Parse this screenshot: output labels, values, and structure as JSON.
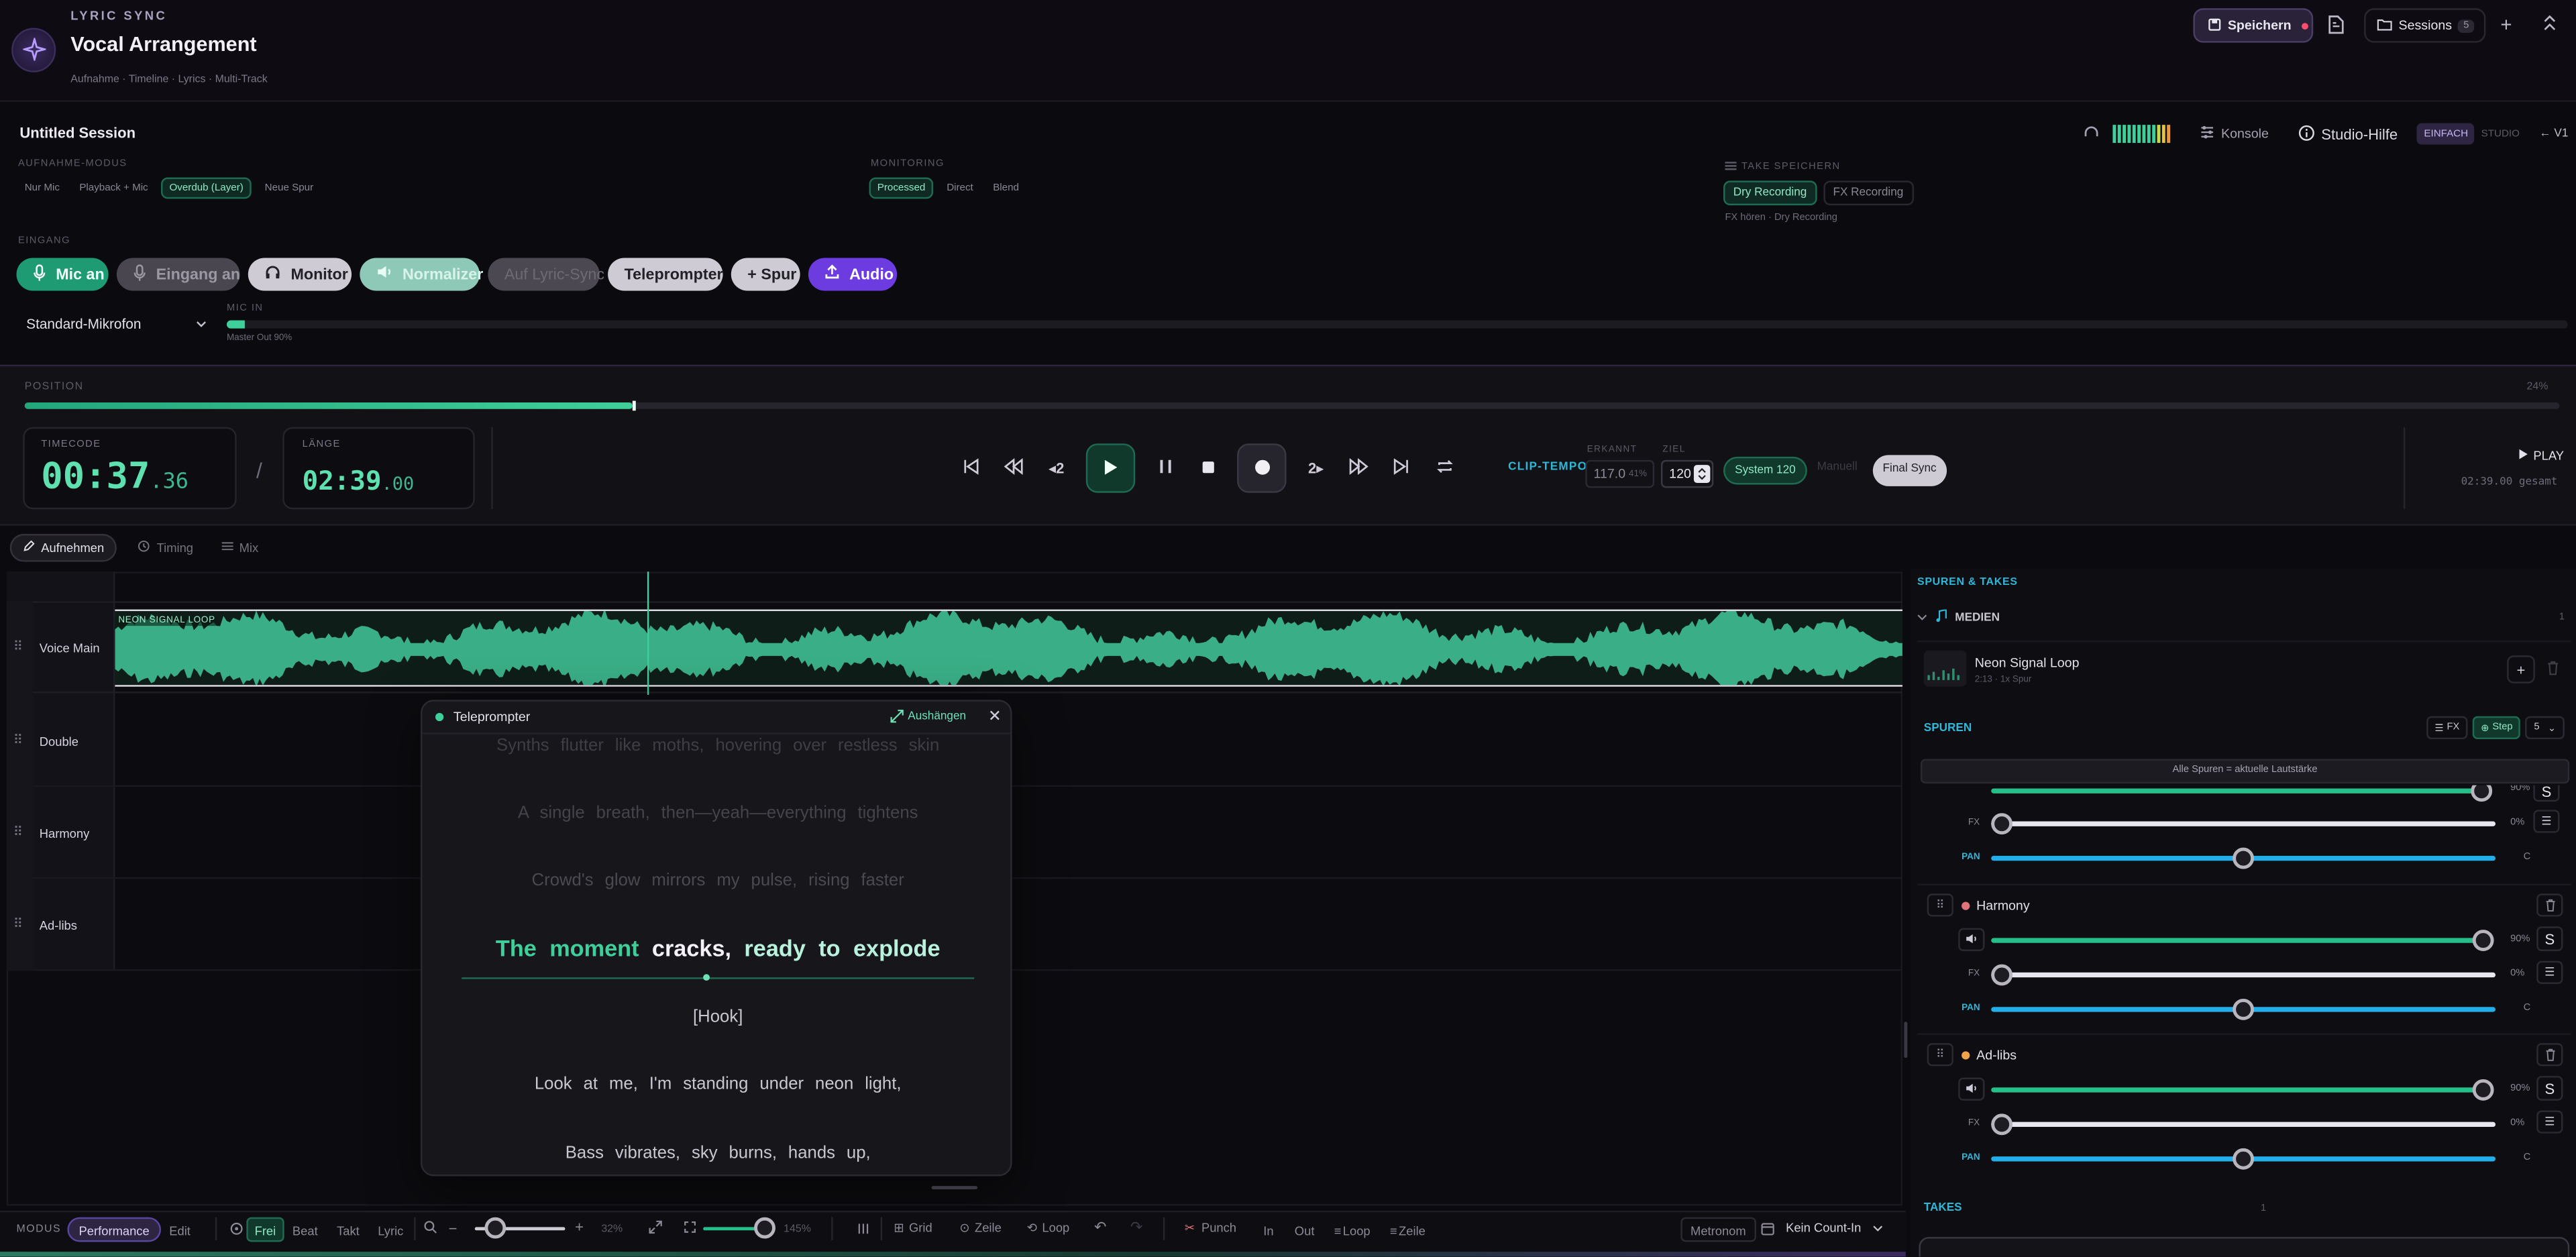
{
  "app": {
    "eyebrow": "LYRIC SYNC",
    "title": "Vocal Arrangement",
    "subtitle": "Aufnahme · Timeline · Lyrics · Multi-Track",
    "save": "Speichern",
    "sessions": "Sessions",
    "sessions_count": "5"
  },
  "session": {
    "name": "Untitled Session",
    "console": "Konsole",
    "help": "Studio-Hilfe",
    "mode_simple": "EINFACH",
    "mode_studio": "STUDIO",
    "version": "V1"
  },
  "record_mode": {
    "label": "AUFNAHME-MODUS",
    "options": [
      "Nur Mic",
      "Playback + Mic",
      "Overdub (Layer)",
      "Neue Spur"
    ]
  },
  "monitoring": {
    "label": "MONITORING",
    "options": [
      "Processed",
      "Direct",
      "Blend"
    ]
  },
  "take_save": {
    "label": "TAKE SPEICHERN",
    "options": [
      "Dry Recording",
      "FX Recording"
    ],
    "hint": "FX hören · Dry Recording"
  },
  "input": {
    "label": "EINGANG",
    "mic": "Mic an",
    "input": "Eingang an",
    "monitor": "Monitor",
    "normalizer": "Normalizer",
    "lyric_sync": "Auf Lyric-Sync",
    "teleprompter": "Teleprompter",
    "add_track": "+ Spur",
    "audio": "Audio",
    "device": "Standard-Mikrofon",
    "mic_in": "MIC IN",
    "master": "Master Out 90%",
    "mic_level": 0.008
  },
  "position": {
    "label": "POSITION",
    "percent": "24%",
    "progress": 0.24,
    "timecode_label": "TIMECODE",
    "timecode": "00:37",
    "timecode_frac": ".36",
    "length_label": "LÄNGE",
    "length": "02:39",
    "length_frac": ".00"
  },
  "transport": {
    "clip_tempo": "CLIP-TEMPO",
    "detected_label": "ERKANNT",
    "detected": "117.0",
    "detected_pct": "41%",
    "target_label": "ZIEL",
    "target": "120",
    "system": "System 120",
    "manual": "Manuell",
    "final": "Final Sync",
    "play": "PLAY",
    "total": "02:39.00 gesamt"
  },
  "tabs": [
    "Aufnehmen",
    "Timing",
    "Mix"
  ],
  "tracks": [
    "Voice Main",
    "Double",
    "Harmony",
    "Ad-libs"
  ],
  "clip": {
    "label": "NEON SIGNAL LOOP"
  },
  "teleprompter": {
    "title": "Teleprompter",
    "detach": "Aushängen",
    "lines": [
      "Synths flutter like moths, hovering over restless skin",
      "A single breath, then—yeah—everything tightens",
      "Crowd's glow mirrors my pulse, rising faster"
    ],
    "current_sung": [
      "The",
      "moment"
    ],
    "current_rest": [
      "cracks,",
      "ready",
      "to",
      "explode"
    ],
    "after": [
      "[Hook]",
      "Look at me, I'm standing under neon light,",
      "Bass vibrates, sky burns, hands up,"
    ]
  },
  "panel": {
    "title": "SPUREN & TAKES",
    "media": "MEDIEN",
    "media_count": "1",
    "media_name": "Neon Signal Loop",
    "media_meta": "2:13 · 1x Spur",
    "tracks_title": "SPUREN",
    "fx": "FX",
    "step": "Step",
    "step_val": "5",
    "all_tracks": "Alle Spuren = aktuelle Lautstärke",
    "fx_lbl": "FX",
    "pan_lbl": "PAN",
    "fx_val": "0%",
    "pan_val": "C",
    "vol_val": "90%",
    "solo": "S",
    "tracks": [
      {
        "name": "Harmony",
        "color": "#e2737a"
      },
      {
        "name": "Ad-libs",
        "color": "#f0a34a"
      }
    ],
    "takes": "TAKES",
    "takes_count": "1"
  },
  "bottom": {
    "mode_label": "MODUS",
    "performance": "Performance",
    "edit": "Edit",
    "frei": "Frei",
    "beat": "Beat",
    "takt": "Takt",
    "lyric": "Lyric",
    "zoom": "32%",
    "zoom_level": 0.21,
    "height": "145%",
    "height_level": 0.85,
    "grid": "Grid",
    "zeile": "Zeile",
    "loop": "Loop",
    "punch": "Punch",
    "in": "In",
    "out": "Out",
    "loop2": "Loop",
    "zeile2": "Zeile",
    "metronom": "Metronom",
    "count_in": "Kein Count-In"
  },
  "colors": {
    "accent": "#3fcf9a",
    "purple": "#6e3fd8",
    "pan": "#22aee8"
  }
}
